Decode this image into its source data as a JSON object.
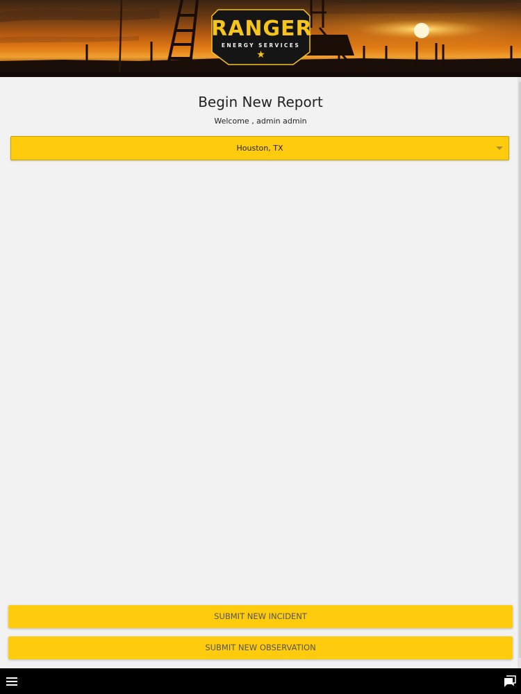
{
  "header": {
    "logo_title": "RANGER",
    "logo_subtitle": "ENERGY SERVICES",
    "logo_star": "★"
  },
  "page": {
    "title": "Begin New Report",
    "welcome": "Welcome , admin admin"
  },
  "location_select": {
    "selected_value": "Houston, TX"
  },
  "actions": {
    "submit_incident_label": "SUBMIT NEW INCIDENT",
    "submit_observation_label": "SUBMIT NEW OBSERVATION"
  },
  "bottom_bar": {
    "menu_icon": "hamburger-menu-icon",
    "chat_icon": "chat-icon"
  },
  "colors": {
    "accent_yellow": "#fecb0d",
    "background": "#f2f2f2",
    "bottom_bar": "#000000"
  }
}
